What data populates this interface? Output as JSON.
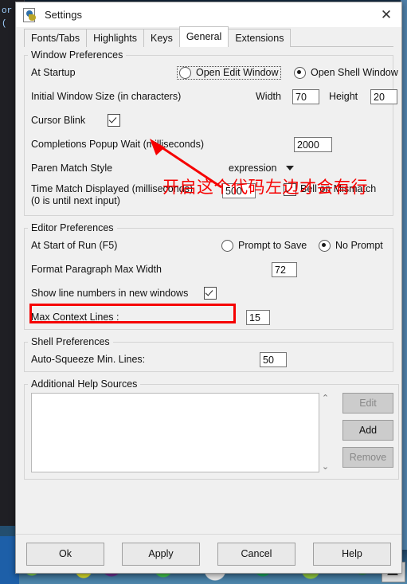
{
  "background": {
    "editor_text": "or\n(\n\n\n\n\n\n\n"
  },
  "window": {
    "title": "Settings",
    "icon": "python-file-icon",
    "close_label": "✕"
  },
  "tabs": [
    {
      "label": "Fonts/Tabs",
      "active": false
    },
    {
      "label": "Highlights",
      "active": false
    },
    {
      "label": "Keys",
      "active": false
    },
    {
      "label": "General",
      "active": true
    },
    {
      "label": "Extensions",
      "active": false
    }
  ],
  "window_preferences": {
    "legend": "Window Preferences",
    "at_startup_label": "At Startup",
    "open_edit_window": "Open Edit Window",
    "open_shell_window": "Open Shell Window",
    "startup_selected": "Open Shell Window",
    "initial_window_size_label": "Initial Window Size  (in characters)",
    "width_label": "Width",
    "width_value": "70",
    "height_label": "Height",
    "height_value": "20",
    "cursor_blink_label": "Cursor Blink",
    "cursor_blink_checked": true,
    "completions_popup_label": "Completions Popup Wait (milliseconds)",
    "completions_popup_value": "2000",
    "paren_match_style_label": "Paren Match Style",
    "paren_match_style_value": "expression",
    "time_match_label_line1": "Time Match Displayed (milliseconds)",
    "time_match_label_line2": "(0 is until next input)",
    "time_match_value": "500",
    "bell_on_mismatch_label": "Bell on Mismatch",
    "bell_on_mismatch_checked": true
  },
  "editor_preferences": {
    "legend": "Editor Preferences",
    "at_start_of_run_label": "At Start of Run (F5)",
    "prompt_to_save": "Prompt to Save",
    "no_prompt": "No Prompt",
    "run_selected": "No Prompt",
    "format_paragraph_label": "Format Paragraph Max Width",
    "format_paragraph_value": "72",
    "show_line_numbers_label": "Show line numbers in new windows",
    "show_line_numbers_checked": true,
    "max_context_lines_label": "Max Context Lines :",
    "max_context_lines_value": "15"
  },
  "shell_preferences": {
    "legend": "Shell Preferences",
    "auto_squeeze_label": "Auto-Squeeze Min. Lines:",
    "auto_squeeze_value": "50"
  },
  "additional_help_sources": {
    "legend": "Additional Help Sources",
    "items": [],
    "scroll_up": "⌃",
    "scroll_down": "⌄",
    "edit_label": "Edit",
    "edit_enabled": false,
    "add_label": "Add",
    "add_enabled": true,
    "remove_label": "Remove",
    "remove_enabled": false
  },
  "footer": {
    "ok_label": "Ok",
    "apply_label": "Apply",
    "cancel_label": "Cancel",
    "help_label": "Help"
  },
  "annotation": {
    "text": "开启这个代码左边才会有行",
    "color": "#f60000"
  }
}
